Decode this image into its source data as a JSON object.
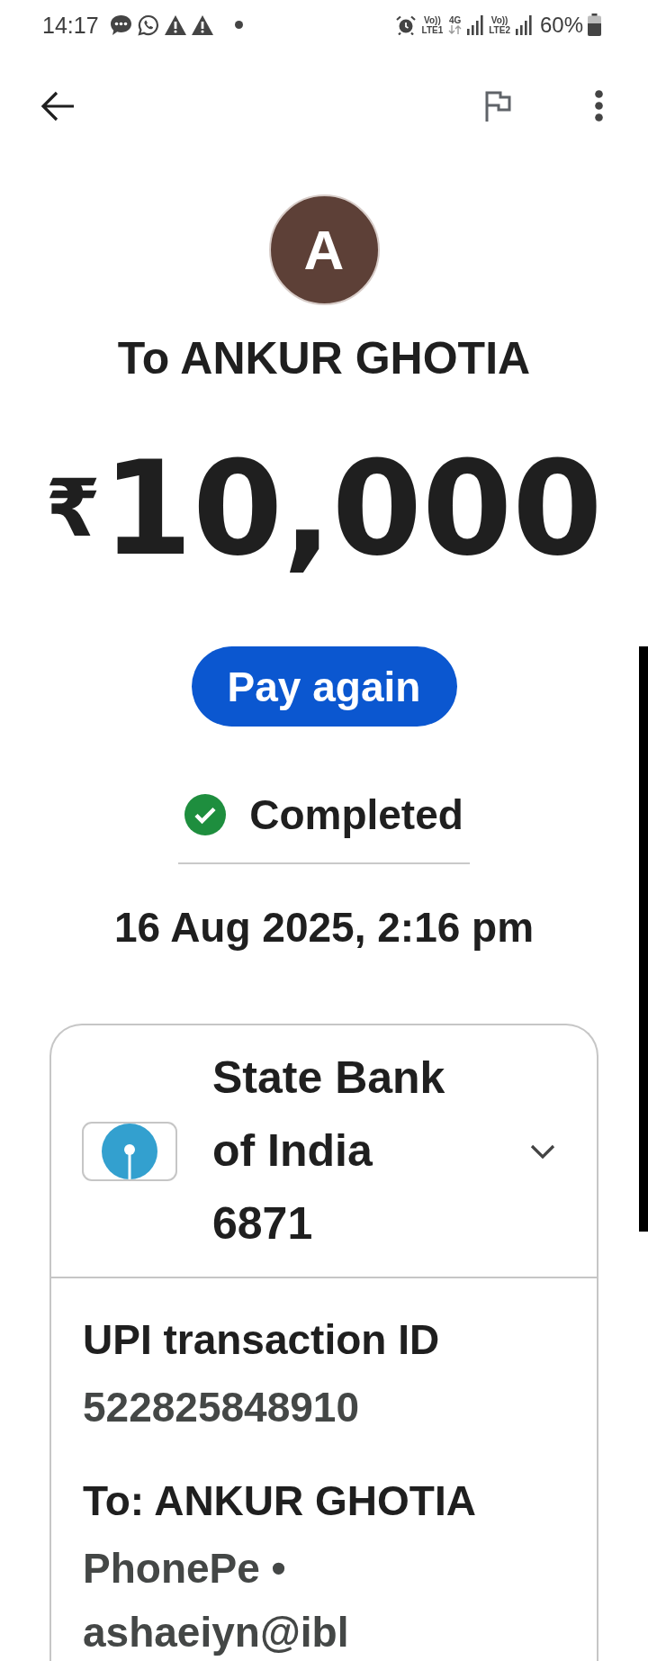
{
  "status_bar": {
    "time": "14:17",
    "network": [
      {
        "volte": "Vo))",
        "band": "LTE1",
        "data": "4G"
      },
      {
        "volte": "Vo))",
        "band": "LTE2"
      }
    ],
    "battery": "60%"
  },
  "recipient": {
    "initial": "A",
    "title": "To ANKUR GHOTIA"
  },
  "amount": {
    "currency": "₹",
    "value": "10,000"
  },
  "pay_again_button": "Pay again",
  "status": {
    "label": "Completed"
  },
  "date": "16 Aug 2025, 2:16 pm",
  "account": {
    "bank_name": "State Bank of India",
    "account_number": "6871",
    "expanded": false
  },
  "details": [
    {
      "label": "UPI transaction ID",
      "value": "522825848910"
    },
    {
      "label": "To: ANKUR GHOTIA",
      "value": "PhonePe • ashaeiyn@ibl"
    }
  ]
}
